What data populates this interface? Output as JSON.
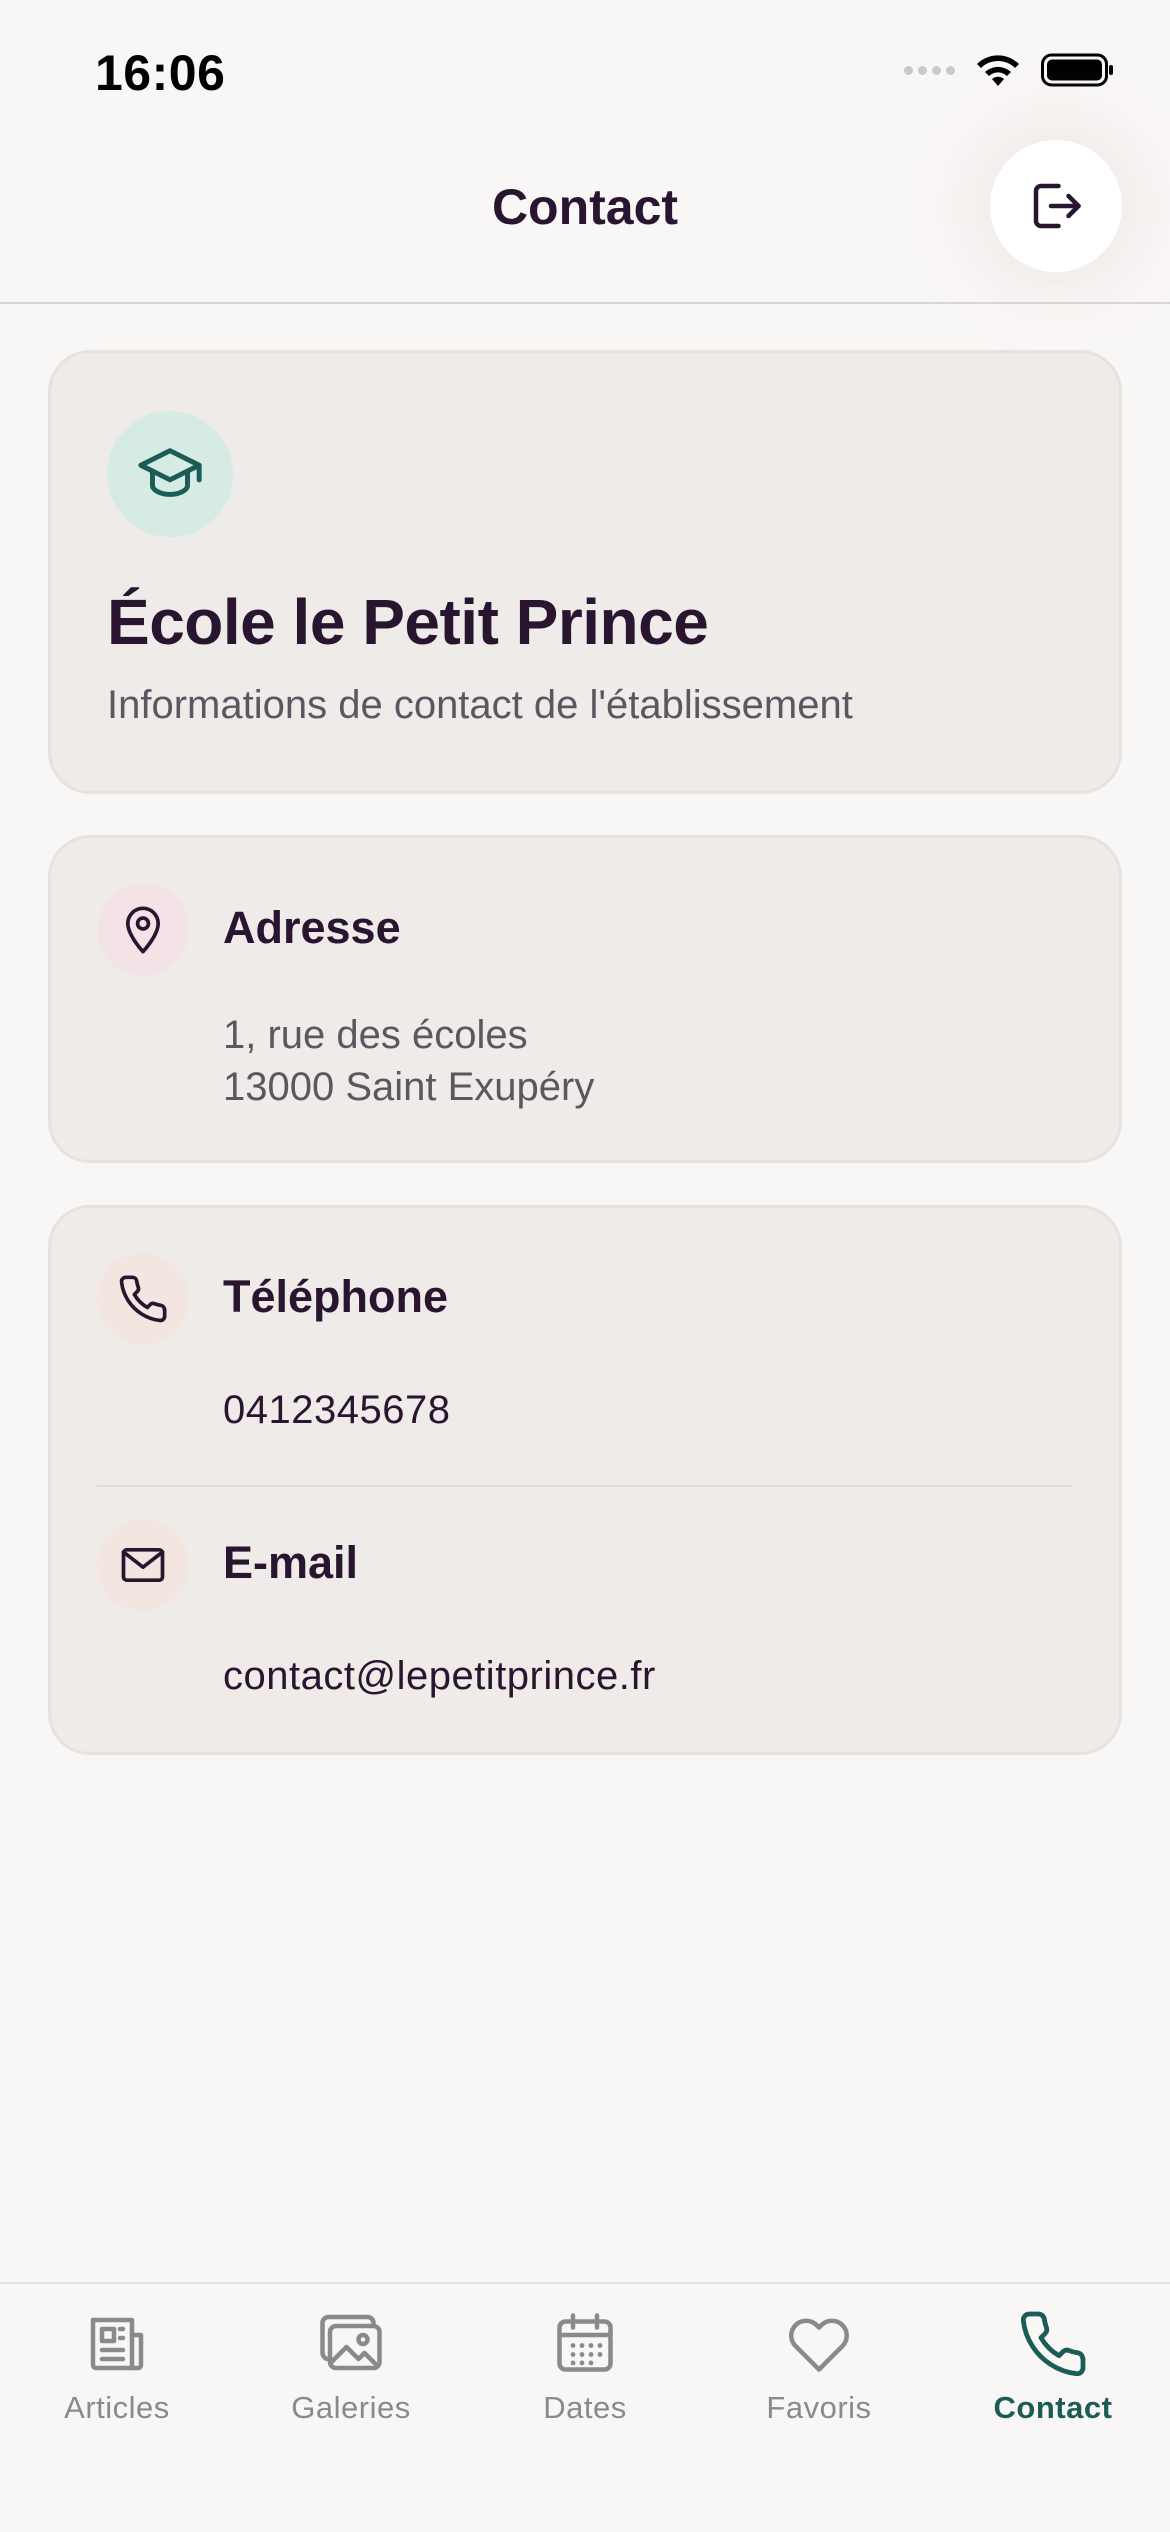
{
  "status_bar": {
    "time": "16:06"
  },
  "header": {
    "title": "Contact"
  },
  "school_card": {
    "icon": "graduation-cap-icon",
    "name": "École le Petit Prince",
    "subtitle": "Informations de contact de l'établissement"
  },
  "address_card": {
    "icon": "map-pin-icon",
    "title": "Adresse",
    "line1": "1, rue des écoles",
    "line2": "13000 Saint Exupéry"
  },
  "contact_card": {
    "phone": {
      "icon": "phone-icon",
      "title": "Téléphone",
      "value": "0412345678"
    },
    "email": {
      "icon": "mail-icon",
      "title": "E-mail",
      "value": "contact@lepetitprince.fr"
    }
  },
  "tabs": [
    {
      "label": "Articles",
      "icon": "newspaper-icon",
      "active": false
    },
    {
      "label": "Galeries",
      "icon": "images-icon",
      "active": false
    },
    {
      "label": "Dates",
      "icon": "calendar-icon",
      "active": false
    },
    {
      "label": "Favoris",
      "icon": "heart-icon",
      "active": false
    },
    {
      "label": "Contact",
      "icon": "phone-icon",
      "active": true
    }
  ],
  "colors": {
    "accent": "#1b5c57",
    "text_primary": "#2a1530",
    "text_secondary": "#5d5560",
    "card_bg": "#efebe9",
    "page_bg": "#f9f7f6"
  }
}
